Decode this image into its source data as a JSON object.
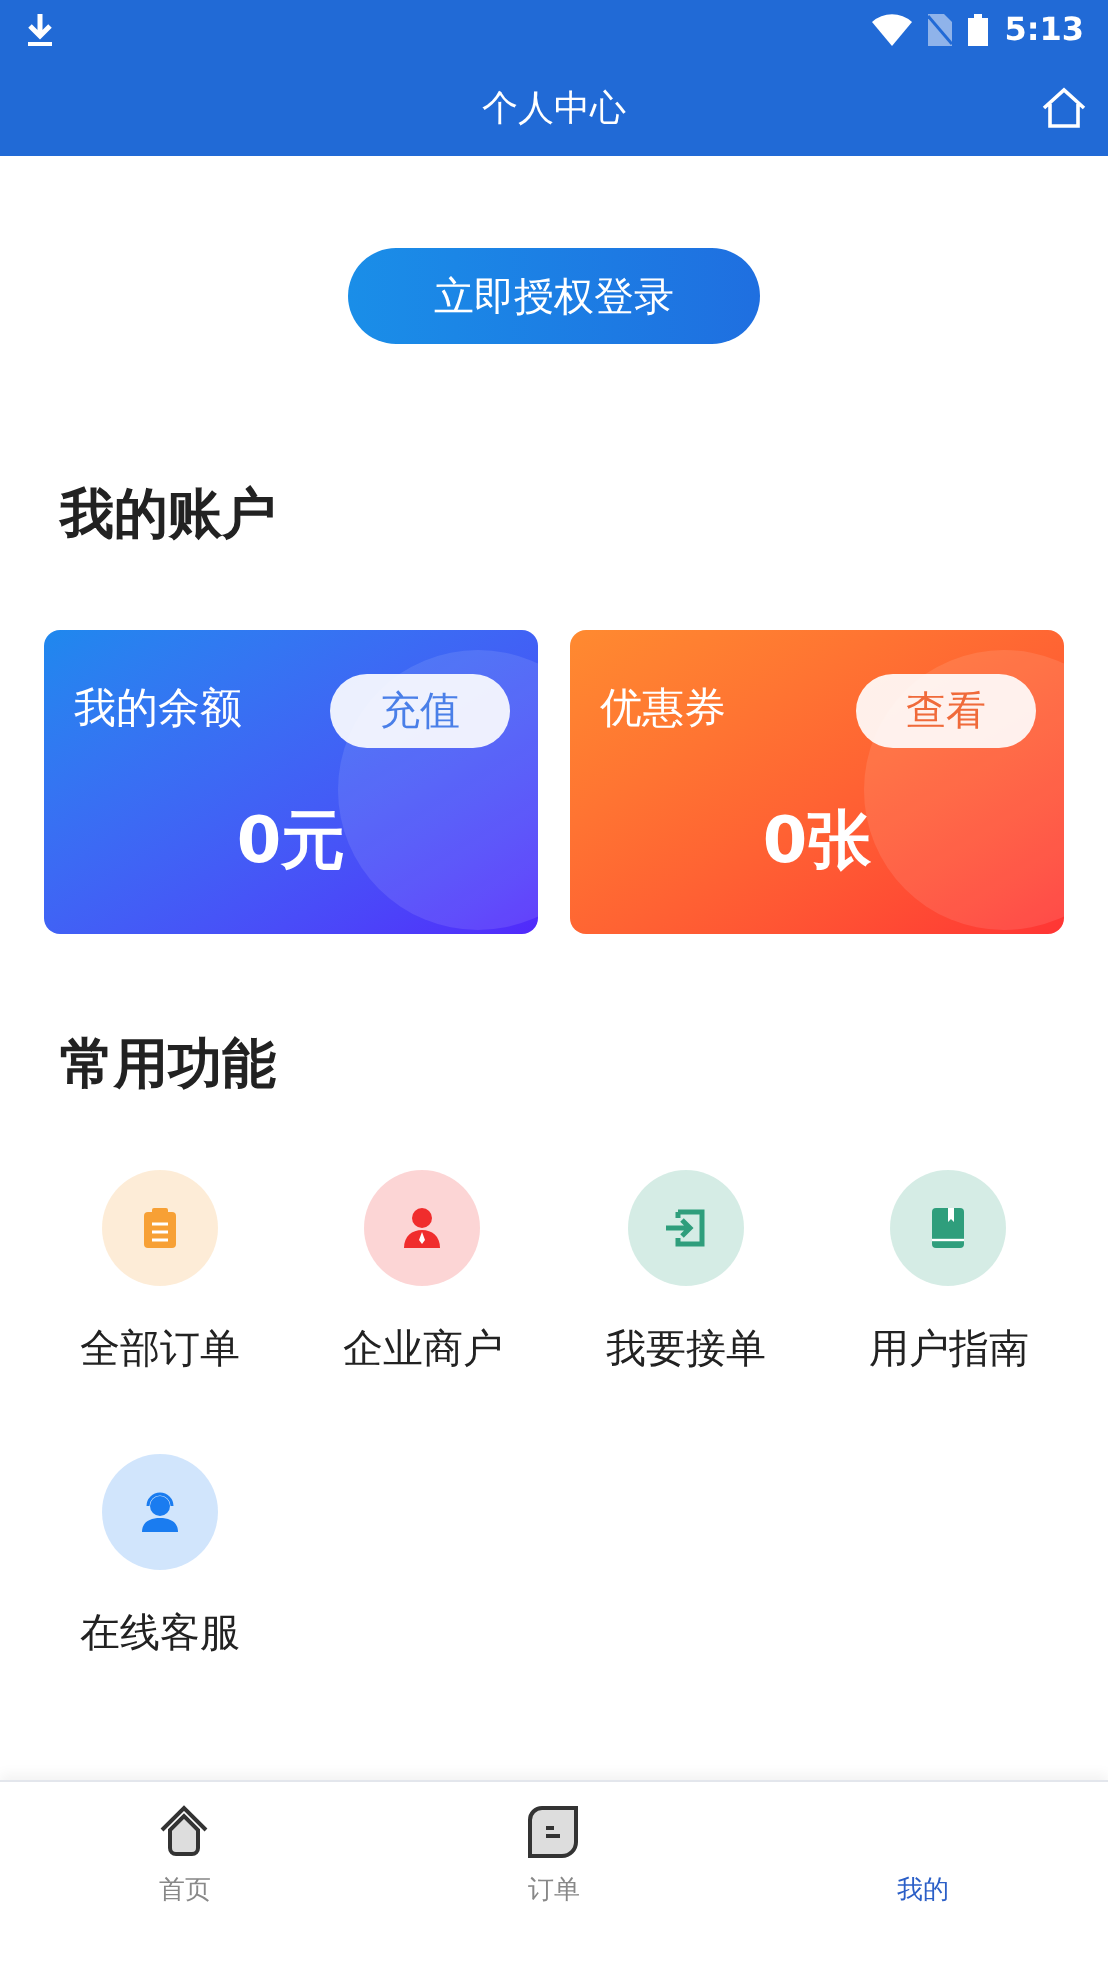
{
  "status_bar": {
    "time": "5:13"
  },
  "header": {
    "title": "个人中心"
  },
  "login_button": {
    "label": "立即授权登录"
  },
  "account": {
    "title": "我的账户",
    "cards": [
      {
        "kind": "balance",
        "label": "我的余额",
        "action": "充值",
        "value": "0元"
      },
      {
        "kind": "coupon",
        "label": "优惠券",
        "action": "查看",
        "value": "0张"
      }
    ]
  },
  "features": {
    "title": "常用功能",
    "items": [
      {
        "kind": "clipboard",
        "label": "全部订单",
        "color": "#f7a035"
      },
      {
        "kind": "person",
        "label": "企业商户",
        "color": "#f02d2d"
      },
      {
        "kind": "enter",
        "label": "我要接单",
        "color": "#2f9e7c"
      },
      {
        "kind": "book",
        "label": "用户指南",
        "color": "#2f9e7c"
      },
      {
        "kind": "support",
        "label": "在线客服",
        "color": "#1a7cf0"
      }
    ]
  },
  "tab_bar": [
    {
      "kind": "home",
      "label": "首页",
      "selected": false
    },
    {
      "kind": "order",
      "label": "订单",
      "selected": false
    },
    {
      "kind": "none",
      "label": "我的",
      "selected": true
    }
  ]
}
